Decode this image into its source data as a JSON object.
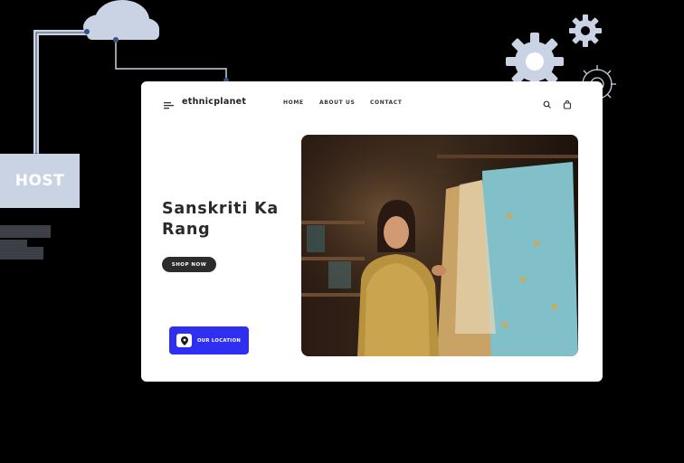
{
  "host_label": "HOST",
  "nav": {
    "brand": "ethnicplanet",
    "links": [
      "HOME",
      "ABOUT US",
      "CONTACT"
    ]
  },
  "hero": {
    "headline": "Sanskriti Ka Rang",
    "shop_button": "SHOP NOW",
    "location_button": "OUR LOCATION"
  },
  "icons": [
    "menu-icon",
    "search-icon",
    "bag-icon",
    "location-pin-icon",
    "gear-icon",
    "cloud-icon"
  ],
  "colors": {
    "accent": "#2f2ff2",
    "dark_button": "#2c2c2c",
    "diagram": "#c9d3e3"
  }
}
